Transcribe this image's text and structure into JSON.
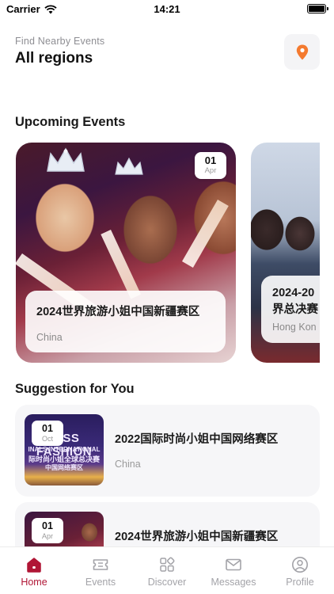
{
  "status_bar": {
    "carrier": "Carrier",
    "time": "14:21"
  },
  "header": {
    "find_label": "Find Nearby Events",
    "region": "All regions"
  },
  "upcoming": {
    "title": "Upcoming Events",
    "cards": [
      {
        "day": "01",
        "month": "Apr",
        "title": "2024世界旅游小姐中国新疆赛区",
        "location": "China"
      },
      {
        "day": "",
        "month": "",
        "title": "2024-20 界总决赛",
        "title_line1": "2024-20",
        "title_line2": "界总决赛",
        "location": "Hong Kon"
      }
    ]
  },
  "suggestion": {
    "title": "Suggestion for You",
    "items": [
      {
        "day": "01",
        "month": "Oct",
        "title": "2022国际时尚小姐中国网络赛区",
        "location": "China",
        "thumb_line1": "MISS FASHION",
        "thumb_line2": "INALS INTERNATIONAL",
        "thumb_line3": "际时尚小姐全球总决赛",
        "thumb_line4": "中国网络赛区"
      },
      {
        "day": "01",
        "month": "Apr",
        "title": "2024世界旅游小姐中国新疆赛区",
        "location": ""
      }
    ]
  },
  "tabs": [
    {
      "label": "Home",
      "icon": "home-icon",
      "active": true
    },
    {
      "label": "Events",
      "icon": "ticket-icon",
      "active": false
    },
    {
      "label": "Discover",
      "icon": "grid-icon",
      "active": false
    },
    {
      "label": "Messages",
      "icon": "envelope-icon",
      "active": false
    },
    {
      "label": "Profile",
      "icon": "person-icon",
      "active": false
    }
  ],
  "colors": {
    "accent": "#b01535",
    "location_pin": "#f47a2f",
    "inactive_tab": "#a3a3a8"
  }
}
